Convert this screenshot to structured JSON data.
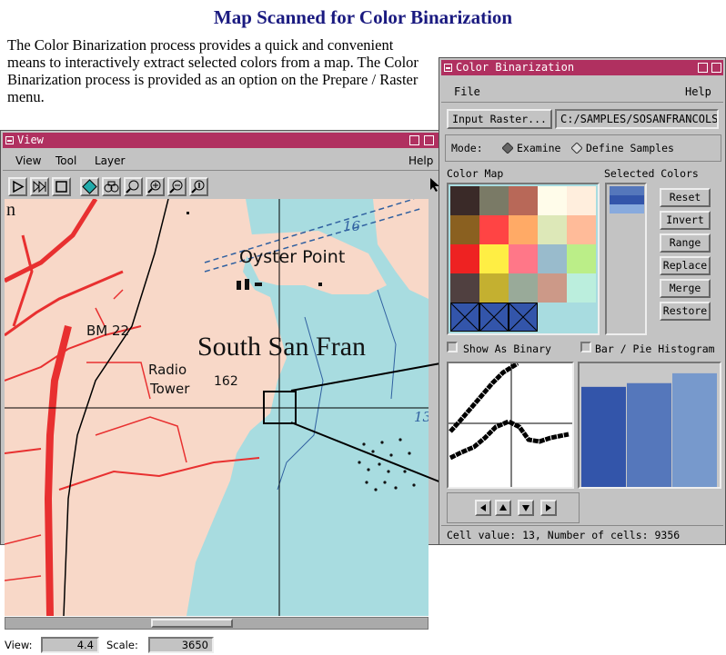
{
  "page": {
    "title": "Map Scanned for Color Binarization",
    "intro": "The Color Binarization process provides a quick and convenient means to interactively extract selected colors from a map.  The Color Binarization process is provided as an option on the Prepare / Raster menu."
  },
  "view_window": {
    "title": "View",
    "menu": [
      "View",
      "Tool",
      "Layer"
    ],
    "help": "Help",
    "toolbar_icons": [
      "play-icon",
      "fast-forward-icon",
      "stop-icon",
      "select-icon",
      "pan-icon",
      "zoom-box-icon",
      "zoom-in-icon",
      "zoom-out-icon",
      "info-icon"
    ],
    "map_labels": {
      "place1": "Oyster Point",
      "place2": "South San Fran",
      "benchmark": "BM 22",
      "radio": "Radio",
      "tower": "Tower",
      "elev": "162",
      "depth1": "16",
      "depth2": "13",
      "edge": "n"
    },
    "status": {
      "view_label": "View:",
      "view_value": "4.4",
      "scale_label": "Scale:",
      "scale_value": "3650"
    }
  },
  "cb_window": {
    "title": "Color Binarization",
    "menu_file": "File",
    "menu_help": "Help",
    "input_raster_label": "Input Raster...",
    "input_raster_path": "C:/SAMPLES/SOSANFRANCOLS",
    "mode_label": "Mode:",
    "mode_examine": "Examine",
    "mode_define": "Define Samples",
    "color_map_label": "Color Map",
    "selected_colors_label": "Selected Colors",
    "color_map": [
      [
        "#3a2a28",
        "#7a7a66",
        "#b86858",
        "#fffcea",
        "#ffeedd"
      ],
      [
        "#8a6020",
        "#ff4444",
        "#ffaa66",
        "#dde8b8",
        "#ffbb99"
      ],
      [
        "#ee2222",
        "#ffee44",
        "#ff7788",
        "#99bbcc",
        "#bbee88"
      ],
      [
        "#504040",
        "#c4b030",
        "#99aa99",
        "#cc9988",
        "#bbeedd"
      ],
      [
        "#3355aa",
        "#3355aa",
        "#3355aa",
        "#a8dce0",
        "#a8dce0"
      ]
    ],
    "selected_colors": [
      "#5577bb",
      "#3355aa",
      "#88aadd"
    ],
    "buttons": [
      "Reset",
      "Invert",
      "Range",
      "Replace",
      "Merge",
      "Restore"
    ],
    "show_binary": "Show As Binary",
    "histogram_toggle": "Bar / Pie Histogram",
    "histogram_values": [
      0.81,
      0.84,
      0.92
    ],
    "histogram_colors": [
      "#3355aa",
      "#5577bb",
      "#7799cc"
    ],
    "status": "Cell value: 13, Number of cells: 9356"
  }
}
